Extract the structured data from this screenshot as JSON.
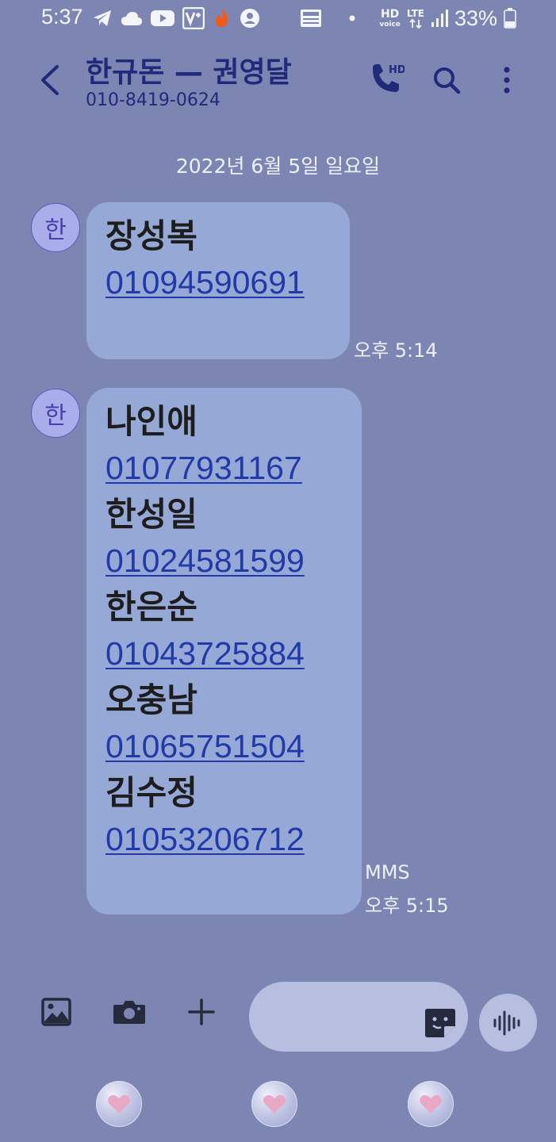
{
  "status_bar": {
    "time": "5:37",
    "battery": "33%",
    "hd_label": "HD",
    "voice_label": "voice",
    "lte_label": "LTE"
  },
  "header": {
    "contact_name": "한규돈 — 권영달",
    "contact_number": "010-8419-0624",
    "call_badge": "HD"
  },
  "date_divider": "2022년 6월 5일 일요일",
  "messages": [
    {
      "avatar": "한",
      "lines": [
        {
          "name": "장성복",
          "phone": "01094590691"
        }
      ],
      "time": "오후 5:14"
    },
    {
      "avatar": "한",
      "lines": [
        {
          "name": "나인애",
          "phone": "01077931167"
        },
        {
          "name": "한성일",
          "phone": "01024581599"
        },
        {
          "name": "한은순",
          "phone": "01043725884"
        },
        {
          "name": "오충남",
          "phone": "01065751504"
        },
        {
          "name": "김수정",
          "phone": "01053206712"
        }
      ],
      "type": "MMS",
      "time": "오후 5:15"
    }
  ],
  "composer": {
    "placeholder": ""
  },
  "colors": {
    "background": "#7d86b3",
    "bubble": "#95a8d6",
    "link": "#2239a8",
    "header_text": "#1f2a7a"
  },
  "icons": [
    "back-arrow-icon",
    "phone-hd-icon",
    "search-icon",
    "more-vertical-icon",
    "gallery-icon",
    "camera-icon",
    "plus-icon",
    "sticker-icon",
    "voice-wave-icon",
    "heart-icon"
  ]
}
